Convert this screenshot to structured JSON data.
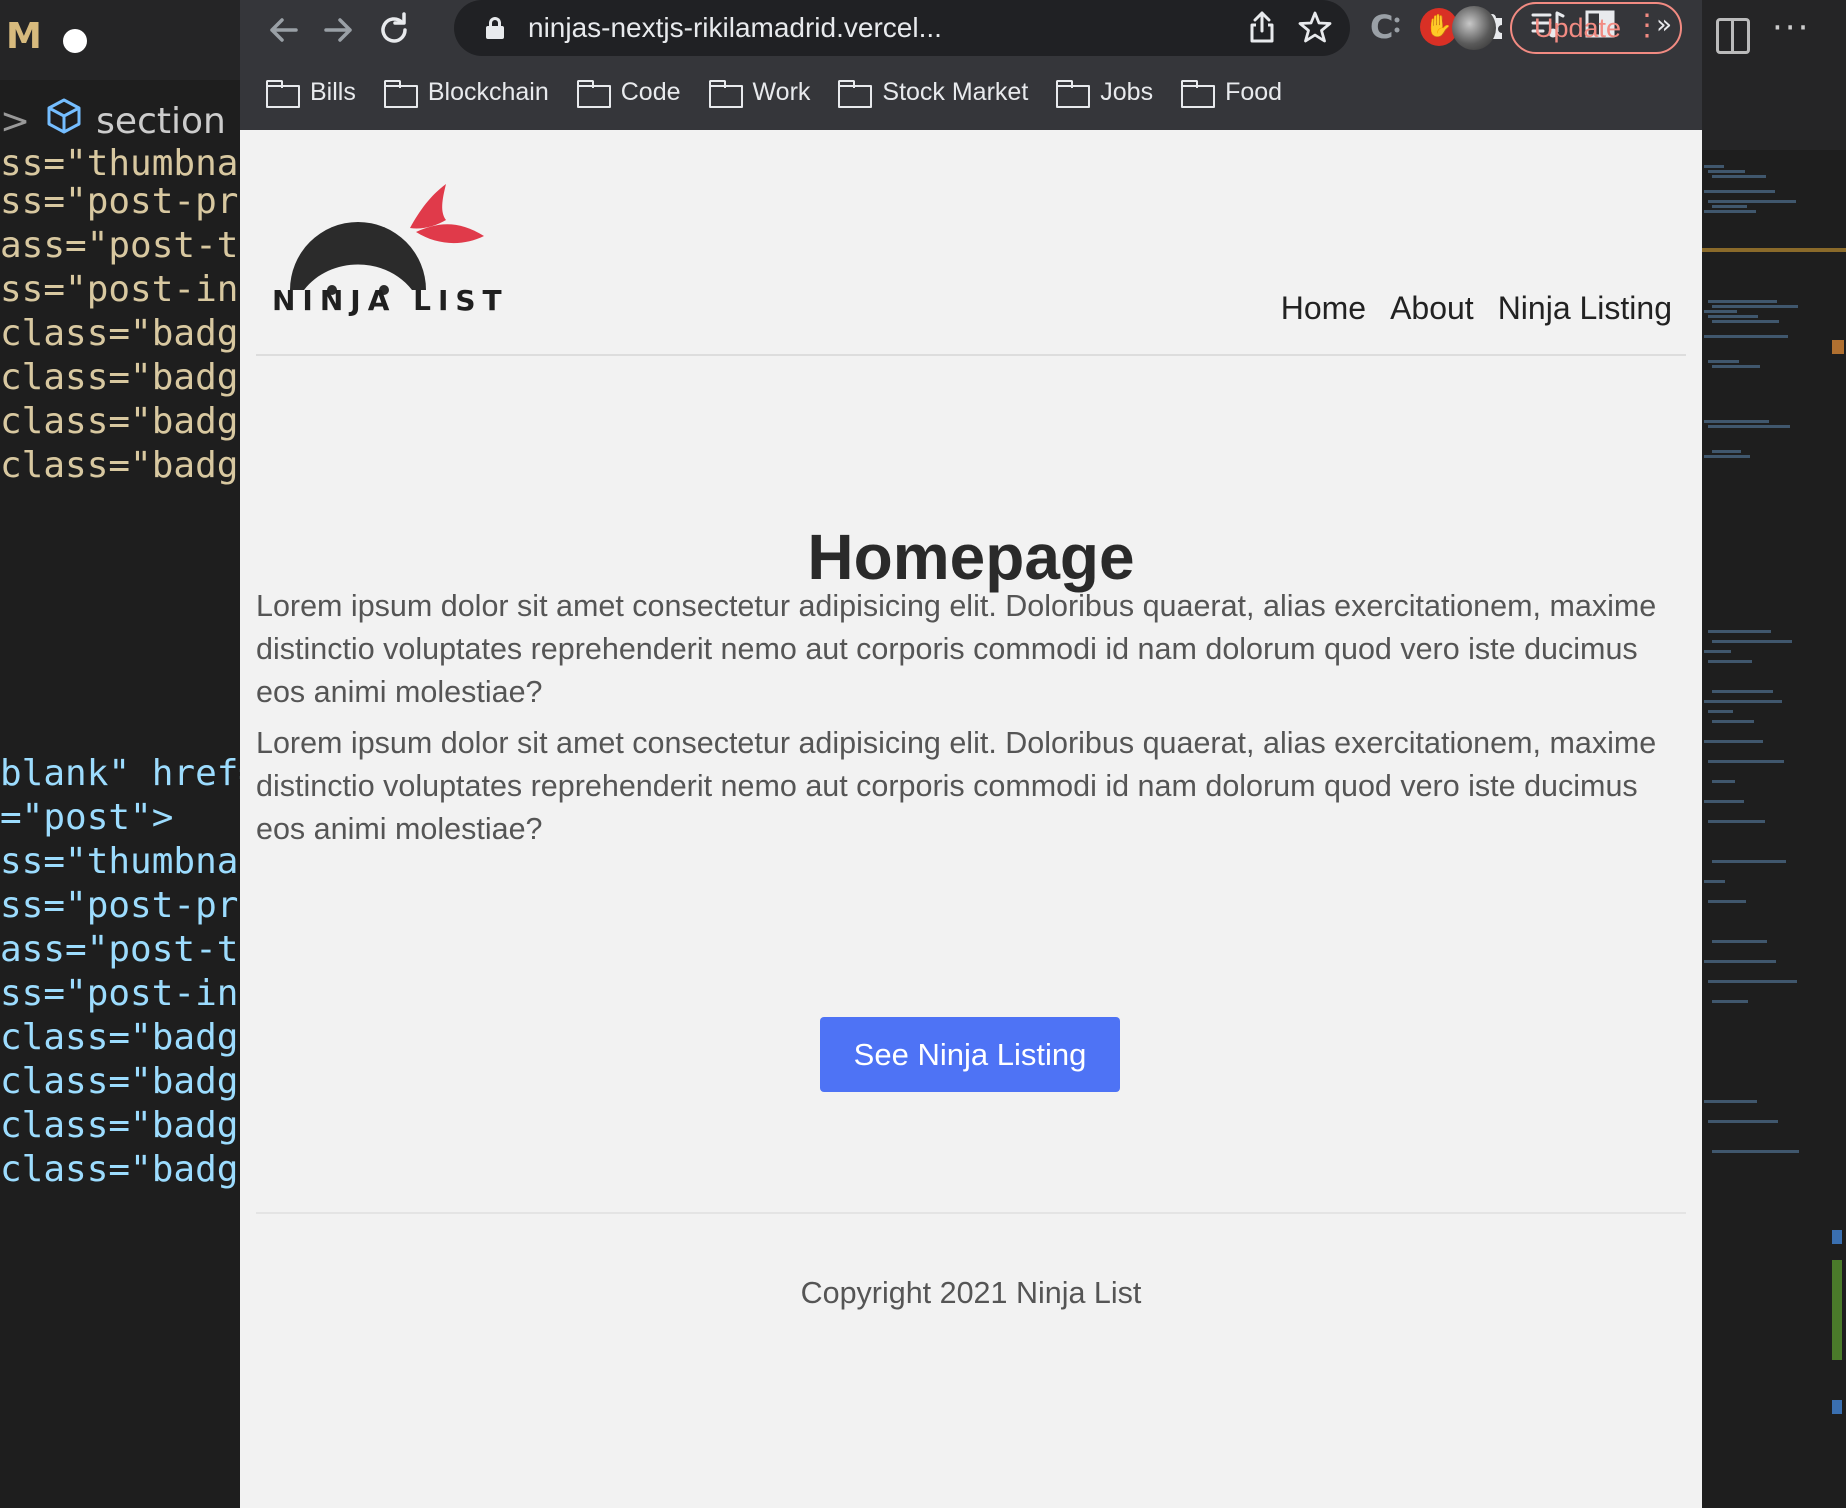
{
  "editor_left": {
    "title_letter": "M",
    "breadcrumb_sep": ">",
    "breadcrumb_label": "section",
    "code_lines": [
      "ss=\"thumbnai",
      "ss=\"post-pre",
      "ass=\"post-ti",
      "ss=\"post-int",
      "class=\"badge",
      "class=\"badge",
      "class=\"badge",
      "class=\"badge",
      "blank\" href=",
      "=\"post\">",
      "ss=\"thumbnai",
      "ss=\"post-pre",
      "ass=\"post-ti",
      "ss=\"post-int",
      "class=\"badge",
      "class=\"badge",
      "class=\"badge",
      "class=\"badge"
    ]
  },
  "browser": {
    "url": "ninjas-nextjs-rikilamadrid.vercel...",
    "update_label": "Update",
    "bookmarks": [
      "Bills",
      "Blockchain",
      "Code",
      "Work",
      "Stock Market",
      "Jobs",
      "Food"
    ],
    "bookmarks_more": "»",
    "icons": {
      "back": "arrow-left",
      "forward": "arrow-right",
      "reload": "reload",
      "share": "share",
      "star": "star",
      "stop": "stop-hand",
      "extensions": "puzzle",
      "media": "music-list",
      "sidepanel": "side-panel",
      "avatar": "profile",
      "menu": "kebab"
    }
  },
  "page": {
    "logo_text": "NINJA LIST",
    "nav": [
      "Home",
      "About",
      "Ninja Listing"
    ],
    "title": "Homepage",
    "paragraphs": [
      "Lorem ipsum dolor sit amet consectetur adipisicing elit. Doloribus quaerat, alias exercitationem, maxime distinctio voluptates reprehenderit nemo aut corporis commodi id nam dolorum quod vero iste ducimus eos animi molestiae?",
      "Lorem ipsum dolor sit amet consectetur adipisicing elit. Doloribus quaerat, alias exercitationem, maxime distinctio voluptates reprehenderit nemo aut corporis commodi id nam dolorum quod vero iste ducimus eos animi molestiae?"
    ],
    "cta_label": "See Ninja Listing",
    "footer": "Copyright 2021 Ninja List"
  },
  "colors": {
    "cta": "#4e73f5",
    "update": "#f28b82",
    "ninja_bandana": "#e03a4a"
  }
}
